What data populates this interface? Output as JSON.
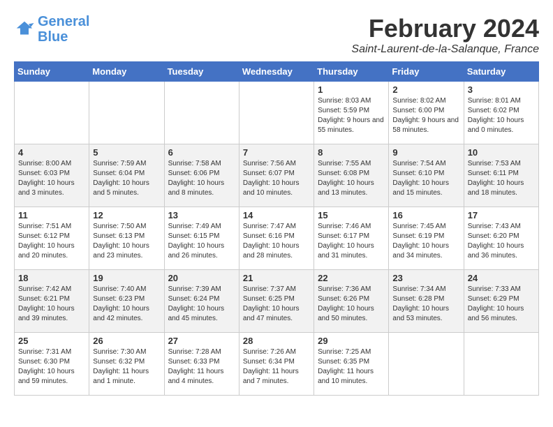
{
  "header": {
    "logo_line1": "General",
    "logo_line2": "Blue",
    "title": "February 2024",
    "subtitle": "Saint-Laurent-de-la-Salanque, France"
  },
  "days_of_week": [
    "Sunday",
    "Monday",
    "Tuesday",
    "Wednesday",
    "Thursday",
    "Friday",
    "Saturday"
  ],
  "weeks": [
    [
      {
        "day": "",
        "info": ""
      },
      {
        "day": "",
        "info": ""
      },
      {
        "day": "",
        "info": ""
      },
      {
        "day": "",
        "info": ""
      },
      {
        "day": "1",
        "info": "Sunrise: 8:03 AM\nSunset: 5:59 PM\nDaylight: 9 hours and 55 minutes."
      },
      {
        "day": "2",
        "info": "Sunrise: 8:02 AM\nSunset: 6:00 PM\nDaylight: 9 hours and 58 minutes."
      },
      {
        "day": "3",
        "info": "Sunrise: 8:01 AM\nSunset: 6:02 PM\nDaylight: 10 hours and 0 minutes."
      }
    ],
    [
      {
        "day": "4",
        "info": "Sunrise: 8:00 AM\nSunset: 6:03 PM\nDaylight: 10 hours and 3 minutes."
      },
      {
        "day": "5",
        "info": "Sunrise: 7:59 AM\nSunset: 6:04 PM\nDaylight: 10 hours and 5 minutes."
      },
      {
        "day": "6",
        "info": "Sunrise: 7:58 AM\nSunset: 6:06 PM\nDaylight: 10 hours and 8 minutes."
      },
      {
        "day": "7",
        "info": "Sunrise: 7:56 AM\nSunset: 6:07 PM\nDaylight: 10 hours and 10 minutes."
      },
      {
        "day": "8",
        "info": "Sunrise: 7:55 AM\nSunset: 6:08 PM\nDaylight: 10 hours and 13 minutes."
      },
      {
        "day": "9",
        "info": "Sunrise: 7:54 AM\nSunset: 6:10 PM\nDaylight: 10 hours and 15 minutes."
      },
      {
        "day": "10",
        "info": "Sunrise: 7:53 AM\nSunset: 6:11 PM\nDaylight: 10 hours and 18 minutes."
      }
    ],
    [
      {
        "day": "11",
        "info": "Sunrise: 7:51 AM\nSunset: 6:12 PM\nDaylight: 10 hours and 20 minutes."
      },
      {
        "day": "12",
        "info": "Sunrise: 7:50 AM\nSunset: 6:13 PM\nDaylight: 10 hours and 23 minutes."
      },
      {
        "day": "13",
        "info": "Sunrise: 7:49 AM\nSunset: 6:15 PM\nDaylight: 10 hours and 26 minutes."
      },
      {
        "day": "14",
        "info": "Sunrise: 7:47 AM\nSunset: 6:16 PM\nDaylight: 10 hours and 28 minutes."
      },
      {
        "day": "15",
        "info": "Sunrise: 7:46 AM\nSunset: 6:17 PM\nDaylight: 10 hours and 31 minutes."
      },
      {
        "day": "16",
        "info": "Sunrise: 7:45 AM\nSunset: 6:19 PM\nDaylight: 10 hours and 34 minutes."
      },
      {
        "day": "17",
        "info": "Sunrise: 7:43 AM\nSunset: 6:20 PM\nDaylight: 10 hours and 36 minutes."
      }
    ],
    [
      {
        "day": "18",
        "info": "Sunrise: 7:42 AM\nSunset: 6:21 PM\nDaylight: 10 hours and 39 minutes."
      },
      {
        "day": "19",
        "info": "Sunrise: 7:40 AM\nSunset: 6:23 PM\nDaylight: 10 hours and 42 minutes."
      },
      {
        "day": "20",
        "info": "Sunrise: 7:39 AM\nSunset: 6:24 PM\nDaylight: 10 hours and 45 minutes."
      },
      {
        "day": "21",
        "info": "Sunrise: 7:37 AM\nSunset: 6:25 PM\nDaylight: 10 hours and 47 minutes."
      },
      {
        "day": "22",
        "info": "Sunrise: 7:36 AM\nSunset: 6:26 PM\nDaylight: 10 hours and 50 minutes."
      },
      {
        "day": "23",
        "info": "Sunrise: 7:34 AM\nSunset: 6:28 PM\nDaylight: 10 hours and 53 minutes."
      },
      {
        "day": "24",
        "info": "Sunrise: 7:33 AM\nSunset: 6:29 PM\nDaylight: 10 hours and 56 minutes."
      }
    ],
    [
      {
        "day": "25",
        "info": "Sunrise: 7:31 AM\nSunset: 6:30 PM\nDaylight: 10 hours and 59 minutes."
      },
      {
        "day": "26",
        "info": "Sunrise: 7:30 AM\nSunset: 6:32 PM\nDaylight: 11 hours and 1 minute."
      },
      {
        "day": "27",
        "info": "Sunrise: 7:28 AM\nSunset: 6:33 PM\nDaylight: 11 hours and 4 minutes."
      },
      {
        "day": "28",
        "info": "Sunrise: 7:26 AM\nSunset: 6:34 PM\nDaylight: 11 hours and 7 minutes."
      },
      {
        "day": "29",
        "info": "Sunrise: 7:25 AM\nSunset: 6:35 PM\nDaylight: 11 hours and 10 minutes."
      },
      {
        "day": "",
        "info": ""
      },
      {
        "day": "",
        "info": ""
      }
    ]
  ]
}
